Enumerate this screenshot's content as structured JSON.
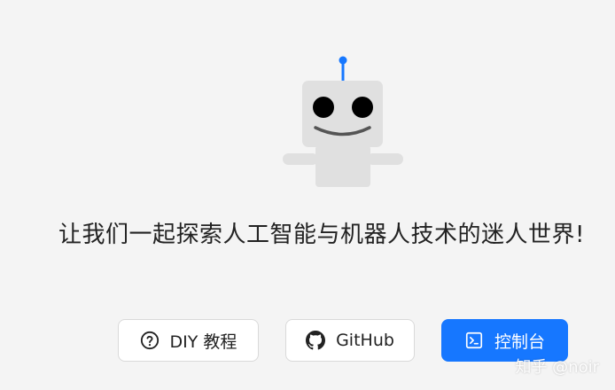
{
  "robot": {
    "icon": "robot-mascot-icon",
    "colors": {
      "body": "#e0e0e0",
      "eyes": "#000000",
      "mouth": "#555555",
      "antenna": "#1677ff"
    }
  },
  "headline": "让我们一起探索人工智能与机器人技术的迷人世界!",
  "buttons": {
    "tutorial": {
      "label": "DIY 教程",
      "icon": "question-circle-icon"
    },
    "github": {
      "label": "GitHub",
      "icon": "github-icon"
    },
    "console": {
      "label": "控制台",
      "icon": "terminal-icon"
    }
  },
  "watermark": "知乎 @noir",
  "colors": {
    "background": "#f4f4f4",
    "primary": "#1677ff",
    "text": "#222222"
  }
}
